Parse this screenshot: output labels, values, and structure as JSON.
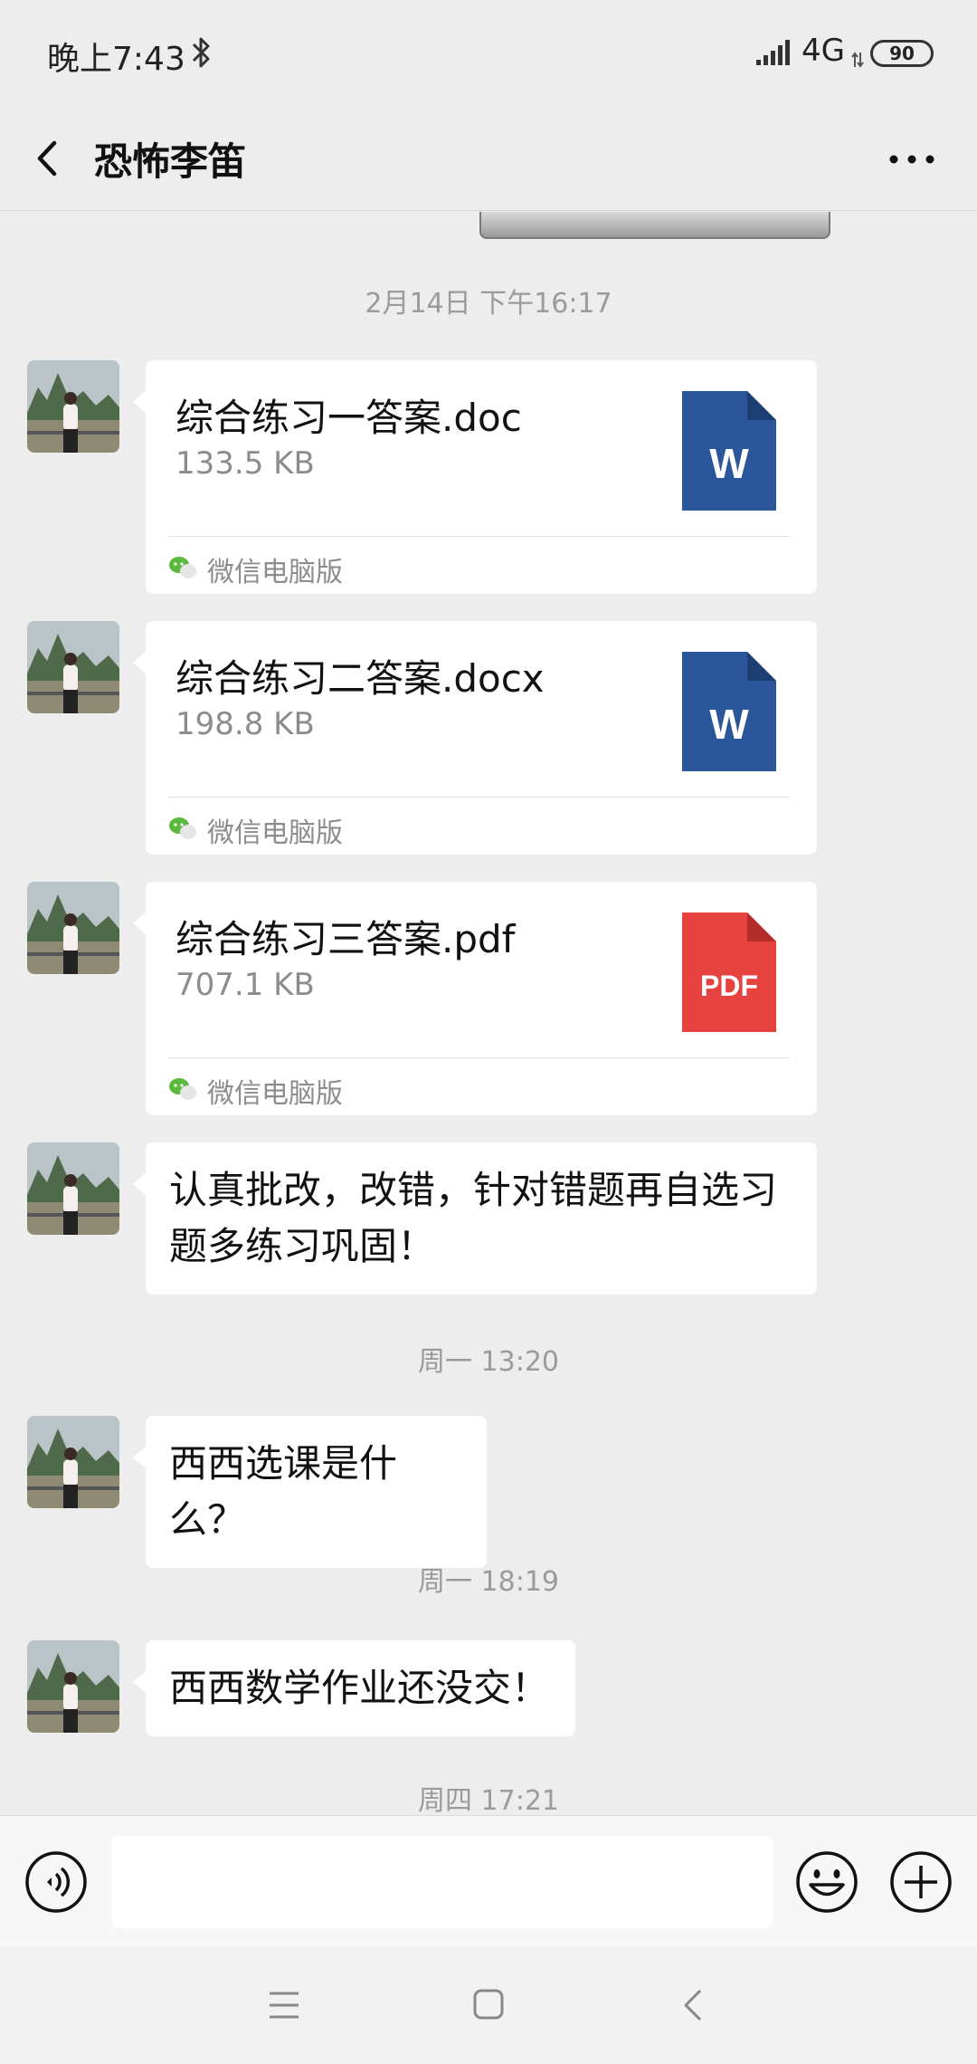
{
  "status_bar": {
    "time": "晚上7:43",
    "network": "4G",
    "battery": "90",
    "icons": [
      "bluetooth-icon",
      "signal-icon",
      "network-arrows-icon",
      "battery-icon"
    ]
  },
  "header": {
    "title": "恐怖李笛",
    "back_icon": "chevron-left-icon",
    "more_icon": "more-dots-icon"
  },
  "messages": {
    "ts1": "2月14日 下午16:17",
    "file1": {
      "name": "综合练习一答案.doc",
      "size": "133.5 KB",
      "badge": "W",
      "source": "微信电脑版",
      "color": "#2b579a"
    },
    "file2": {
      "name": "综合练习二答案.docx",
      "size": "198.8 KB",
      "badge": "W",
      "source": "微信电脑版",
      "color": "#2b579a"
    },
    "file3": {
      "name": "综合练习三答案.pdf",
      "size": "707.1 KB",
      "badge": "PDF",
      "source": "微信电脑版",
      "color": "#e64340"
    },
    "text1": "认真批改，改错，针对错题再自选习题多练习巩固！",
    "ts2": "周一 13:20",
    "text2": "西西选课是什么？",
    "ts3": "周一 18:19",
    "text3": "西西数学作业还没交！",
    "ts4": "周四 17:21"
  },
  "input_bar": {
    "icons": [
      "voice-icon",
      "emoji-icon",
      "plus-icon"
    ]
  },
  "system_nav": {
    "icons": [
      "menu-icon",
      "home-icon",
      "back-nav-icon"
    ]
  }
}
